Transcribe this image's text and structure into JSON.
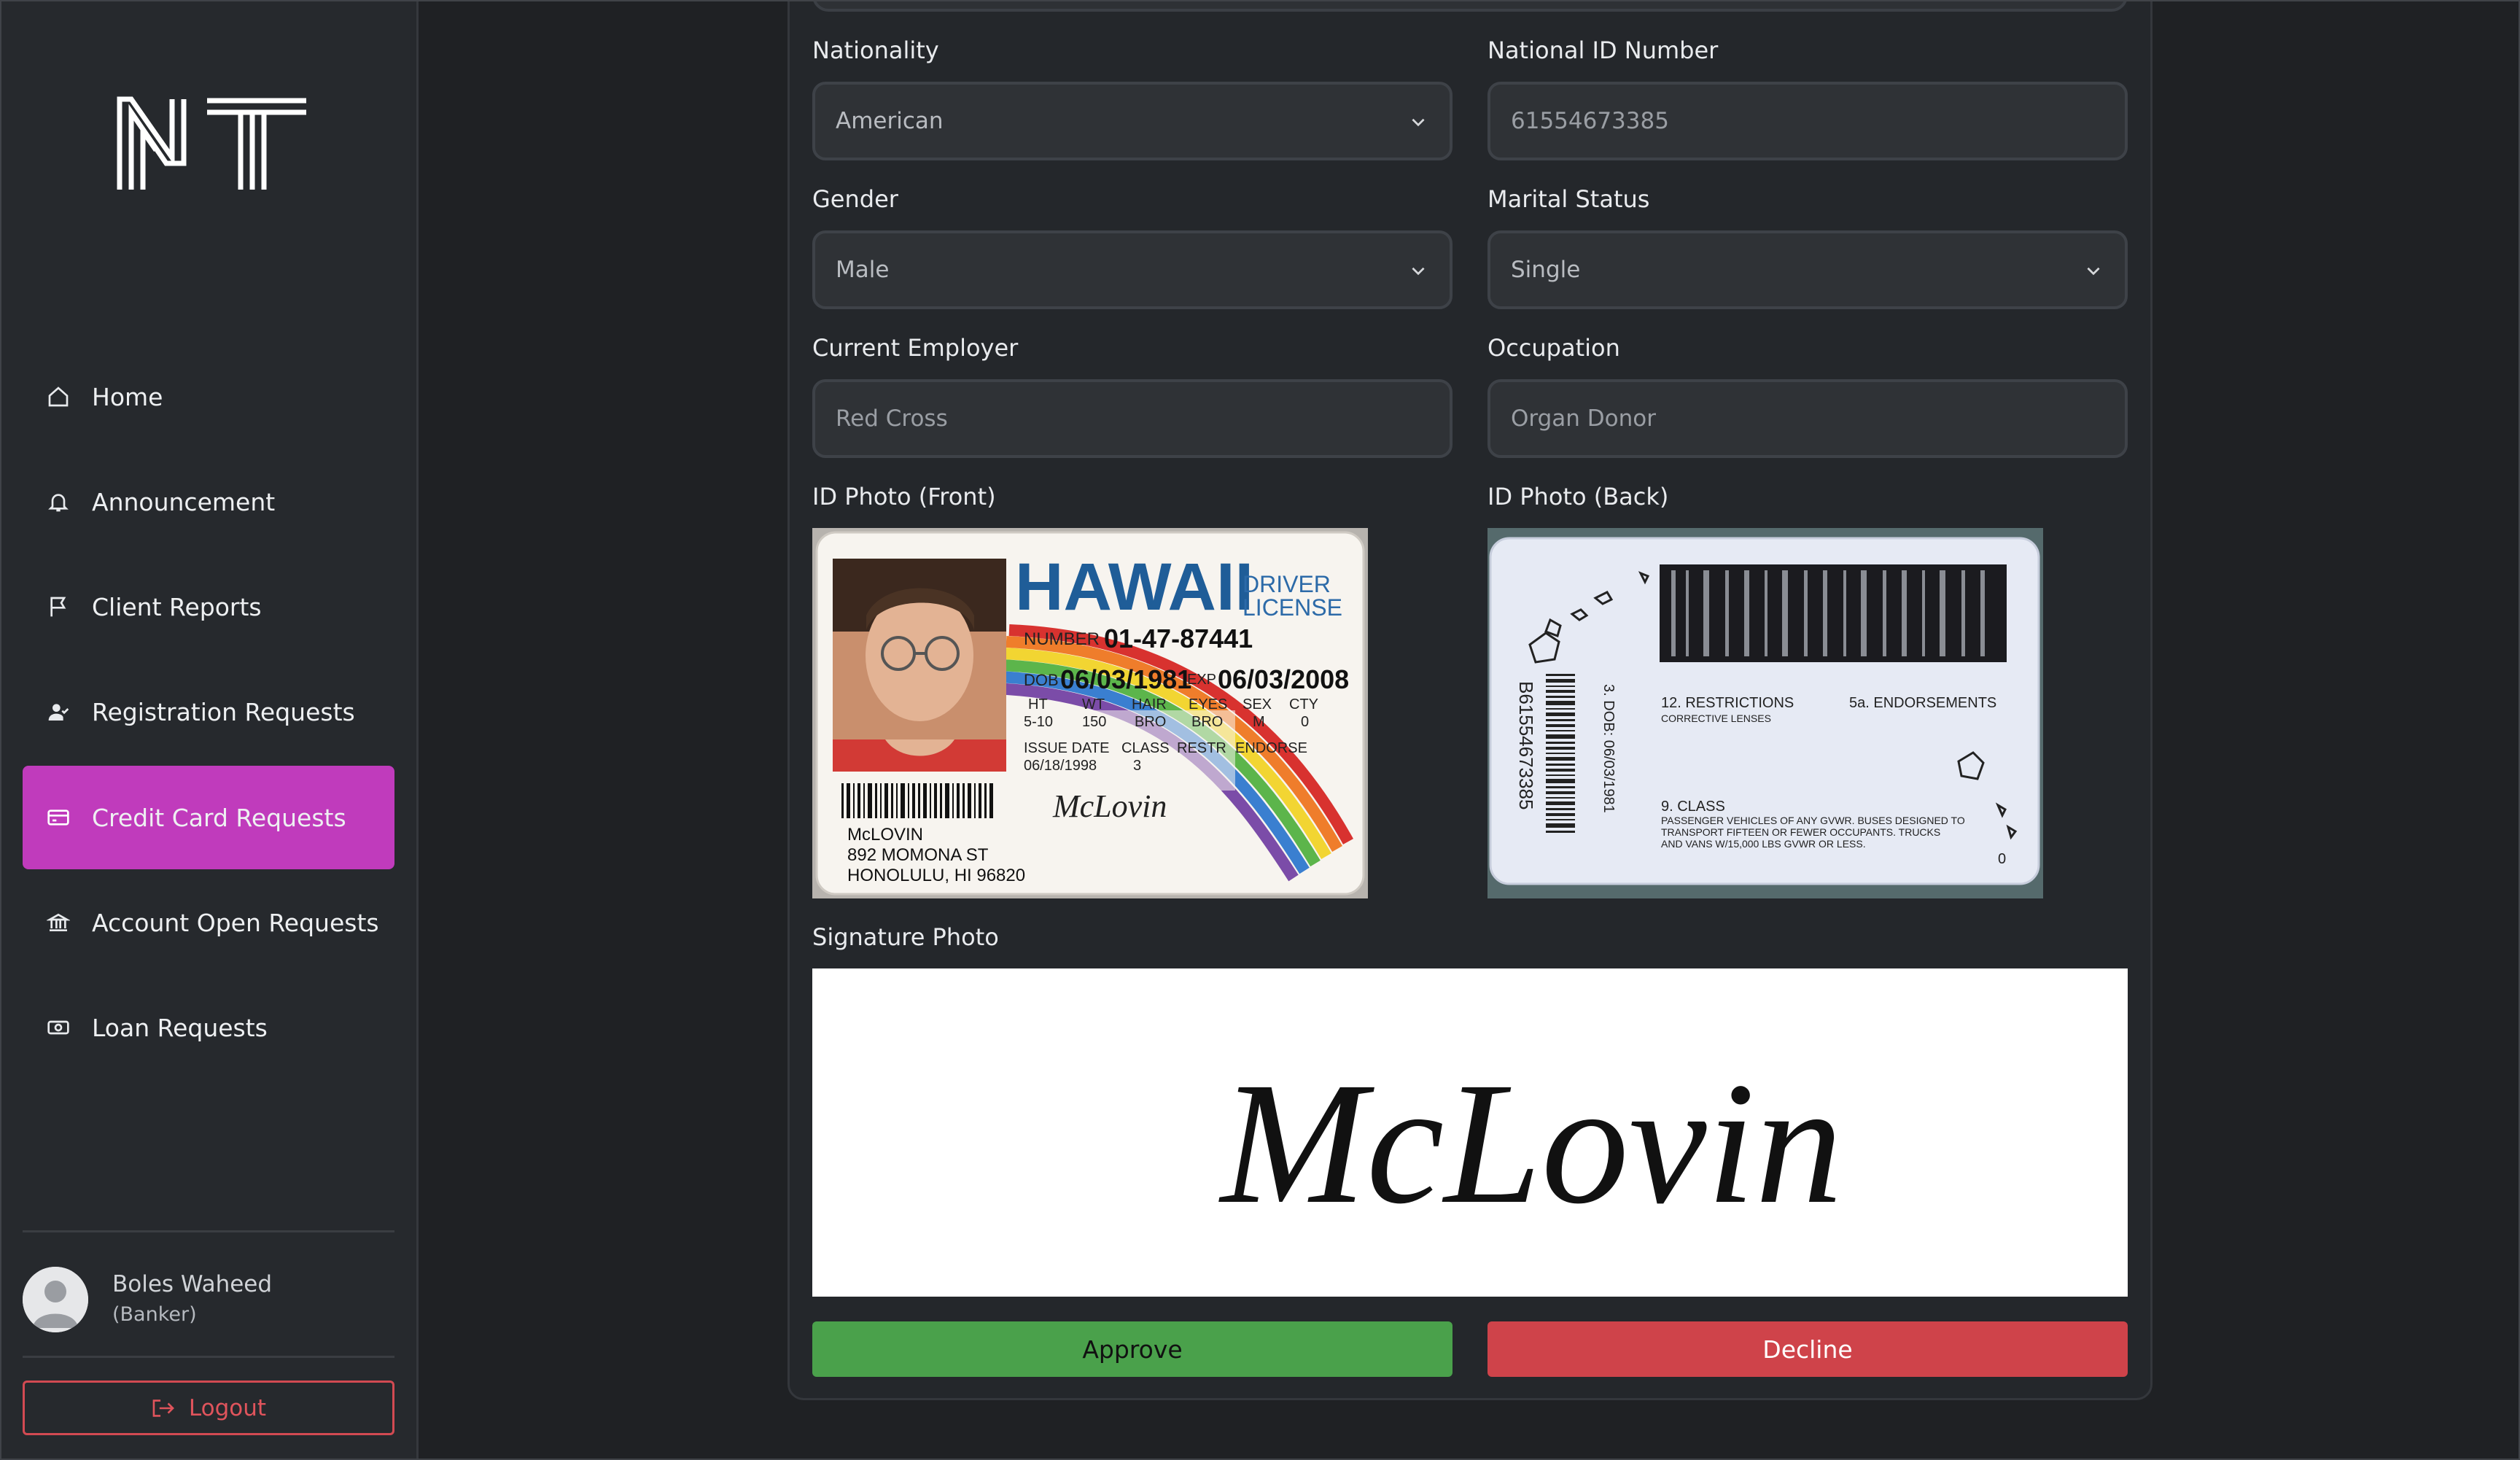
{
  "brand": {
    "logo_text": "NT"
  },
  "sidebar": {
    "items": [
      {
        "label": "Home",
        "icon": "home-icon"
      },
      {
        "label": "Announcement",
        "icon": "bell-icon"
      },
      {
        "label": "Client Reports",
        "icon": "flag-icon"
      },
      {
        "label": "Registration Requests",
        "icon": "user-check-icon"
      },
      {
        "label": "Credit Card Requests",
        "icon": "credit-card-icon",
        "active": true
      },
      {
        "label": "Account Open Requests",
        "icon": "bank-icon"
      },
      {
        "label": "Loan Requests",
        "icon": "money-icon"
      }
    ],
    "accent_color": "#c03bbc"
  },
  "user": {
    "name": "Boles Waheed",
    "role": "(Banker)"
  },
  "logout": {
    "label": "Logout"
  },
  "form": {
    "nationality": {
      "label": "Nationality",
      "value": "American"
    },
    "national_id": {
      "label": "National ID Number",
      "value": "61554673385"
    },
    "gender": {
      "label": "Gender",
      "value": "Male"
    },
    "marital_status": {
      "label": "Marital Status",
      "value": "Single"
    },
    "current_employer": {
      "label": "Current Employer",
      "value": "Red Cross"
    },
    "occupation": {
      "label": "Occupation",
      "value": "Organ Donor"
    },
    "id_front": {
      "label": "ID Photo (Front)",
      "state": "HAWAII",
      "doc_type": "DRIVER",
      "doc_type2": "LICENSE",
      "number_label": "NUMBER",
      "number": "01-47-87441",
      "dob_label": "DOB",
      "dob": "06/03/1981",
      "exp_label": "EXP",
      "exp": "06/03/2008",
      "attr_labels": [
        "HT",
        "WT",
        "HAIR",
        "EYES",
        "SEX",
        "CTY"
      ],
      "attr_values": [
        "5-10",
        "150",
        "BRO",
        "BRO",
        "M",
        "0"
      ],
      "issue_label": "ISSUE DATE",
      "issue": "06/18/1998",
      "class_label": "CLASS",
      "class": "3",
      "restr_label": "RESTR",
      "endorse_label": "ENDORSE",
      "name": "McLOVIN",
      "address1": "892 MOMONA ST",
      "address2": "HONOLULU, HI 96820",
      "signature": "McLovin"
    },
    "id_back": {
      "label": "ID Photo (Back)",
      "vertical_number": "B61554673385",
      "dob_line": "3. DOB: 06/03/1981",
      "restrictions": "12. RESTRICTIONS",
      "restrictions_detail": "CORRECTIVE LENSES",
      "endorsements": "5a. ENDORSEMENTS",
      "class_heading": "9. CLASS",
      "class_lines": [
        "PASSENGER VEHICLES OF ANY GVWR. BUSES DESIGNED TO",
        "TRANSPORT FIFTEEN OR FEWER OCCUPANTS. TRUCKS",
        "AND VANS W/15,000 LBS GVWR OR LESS."
      ],
      "corner": "0"
    },
    "signature": {
      "label": "Signature Photo",
      "text": "McLovin"
    }
  },
  "actions": {
    "approve_label": "Approve",
    "decline_label": "Decline"
  },
  "colors": {
    "approve": "#4aa14b",
    "decline": "#cf434a",
    "logout": "#e0545c"
  }
}
